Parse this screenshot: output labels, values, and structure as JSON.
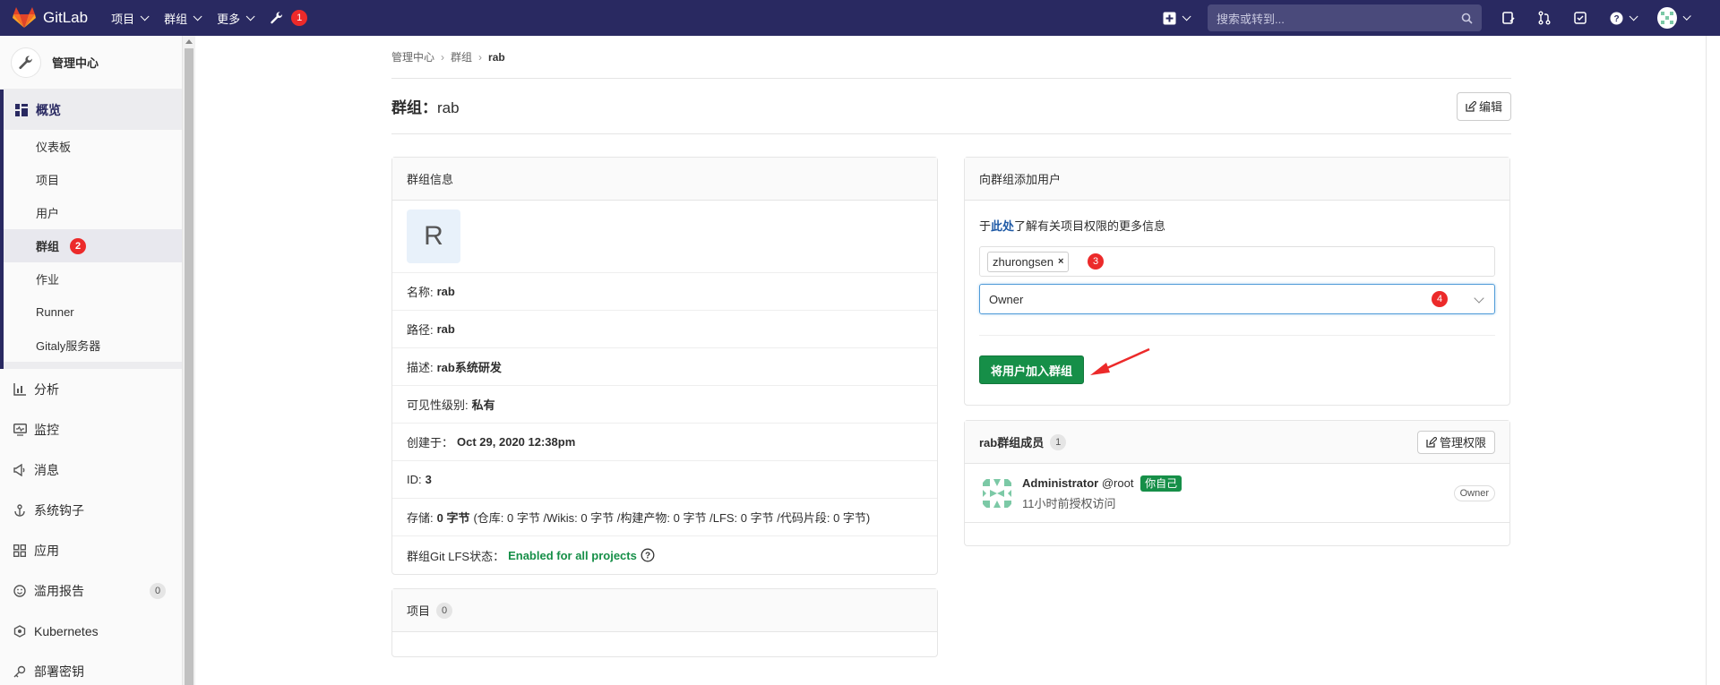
{
  "navbar": {
    "brand": "GitLab",
    "menu": [
      {
        "label": "项目"
      },
      {
        "label": "群组"
      },
      {
        "label": "更多"
      }
    ],
    "wrench_badge": "1",
    "search_placeholder": "搜索或转到..."
  },
  "sidebar": {
    "header": "管理中心",
    "overview": "概览",
    "sub_items": [
      "仪表板",
      "项目",
      "用户",
      "群组",
      "作业",
      "Runner",
      "Gitaly服务器"
    ],
    "group_badge": "2",
    "main_items": [
      {
        "label": "分析",
        "icon": "chart-icon"
      },
      {
        "label": "监控",
        "icon": "monitor-icon"
      },
      {
        "label": "消息",
        "icon": "bullhorn-icon"
      },
      {
        "label": "系统钩子",
        "icon": "hook-icon"
      },
      {
        "label": "应用",
        "icon": "grid-icon"
      },
      {
        "label": "滥用报告",
        "icon": "smile-icon",
        "count": "0"
      },
      {
        "label": "Kubernetes",
        "icon": "cloud-icon"
      },
      {
        "label": "部署密钥",
        "icon": "key-icon"
      }
    ]
  },
  "breadcrumb": [
    "管理中心",
    "群组",
    "rab"
  ],
  "page": {
    "title_prefix": "群组：",
    "title_name": "rab",
    "edit_label": "编辑"
  },
  "group_info": {
    "header": "群组信息",
    "avatar_letter": "R",
    "rows": [
      {
        "label": "名称:",
        "value": "rab"
      },
      {
        "label": "路径:",
        "value": "rab"
      },
      {
        "label": "描述:",
        "value": "rab系统研发"
      },
      {
        "label": "可见性级别:",
        "value": "私有"
      },
      {
        "label": "创建于：",
        "value": "Oct 29, 2020 12:38pm"
      },
      {
        "label": "ID:",
        "value": "3"
      }
    ],
    "storage_label": "存储:",
    "storage_value": "0 字节",
    "storage_detail": "(仓库: 0 字节 /Wikis: 0 字节 /构建产物: 0 字节 /LFS: 0 字节 /代码片段: 0 字节)",
    "lfs_label": "群组Git LFS状态：",
    "lfs_value": "Enabled for all projects"
  },
  "projects_card": {
    "header": "项目",
    "count": "0"
  },
  "add_user": {
    "header": "向群组添加用户",
    "info_prefix": "于",
    "info_link": "此处",
    "info_suffix": "了解有关项目权限的更多信息",
    "token": "zhurongsen",
    "token_remove": "×",
    "token_annotation": "3",
    "role_value": "Owner",
    "role_annotation": "4",
    "submit_label": "将用户加入群组"
  },
  "members": {
    "header": "rab群组成员",
    "count": "1",
    "manage_label": "管理权限",
    "list": [
      {
        "name": "Administrator",
        "username": "@root",
        "you_badge": "你自己",
        "meta": "11小时前授权访问",
        "role": "Owner"
      }
    ]
  }
}
